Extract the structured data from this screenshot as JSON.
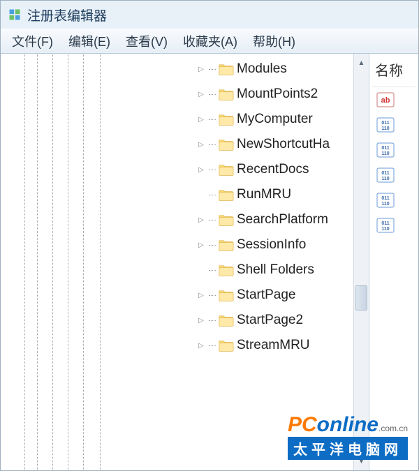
{
  "window": {
    "title": "注册表编辑器"
  },
  "menu": {
    "file": "文件(F)",
    "edit": "编辑(E)",
    "view": "查看(V)",
    "favorites": "收藏夹(A)",
    "help": "帮助(H)"
  },
  "tree": {
    "items": [
      {
        "label": "Modules",
        "expandable": true
      },
      {
        "label": "MountPoints2",
        "expandable": true
      },
      {
        "label": "MyComputer",
        "expandable": true
      },
      {
        "label": "NewShortcutHa",
        "expandable": true
      },
      {
        "label": "RecentDocs",
        "expandable": true
      },
      {
        "label": "RunMRU",
        "expandable": false
      },
      {
        "label": "SearchPlatform",
        "expandable": true
      },
      {
        "label": "SessionInfo",
        "expandable": true
      },
      {
        "label": "Shell Folders",
        "expandable": false
      },
      {
        "label": "StartPage",
        "expandable": true
      },
      {
        "label": "StartPage2",
        "expandable": true
      },
      {
        "label": "StreamMRU",
        "expandable": true
      }
    ]
  },
  "right": {
    "column_header": "名称",
    "values": [
      {
        "type": "string"
      },
      {
        "type": "binary"
      },
      {
        "type": "binary"
      },
      {
        "type": "binary"
      },
      {
        "type": "binary"
      },
      {
        "type": "binary"
      }
    ]
  },
  "watermark": {
    "brand_prefix": "PC",
    "brand_suffix": "online",
    "domain": ".com.cn",
    "subtitle": "太平洋电脑网"
  },
  "indent_line_positions": [
    34,
    52,
    74,
    96,
    118,
    142
  ]
}
